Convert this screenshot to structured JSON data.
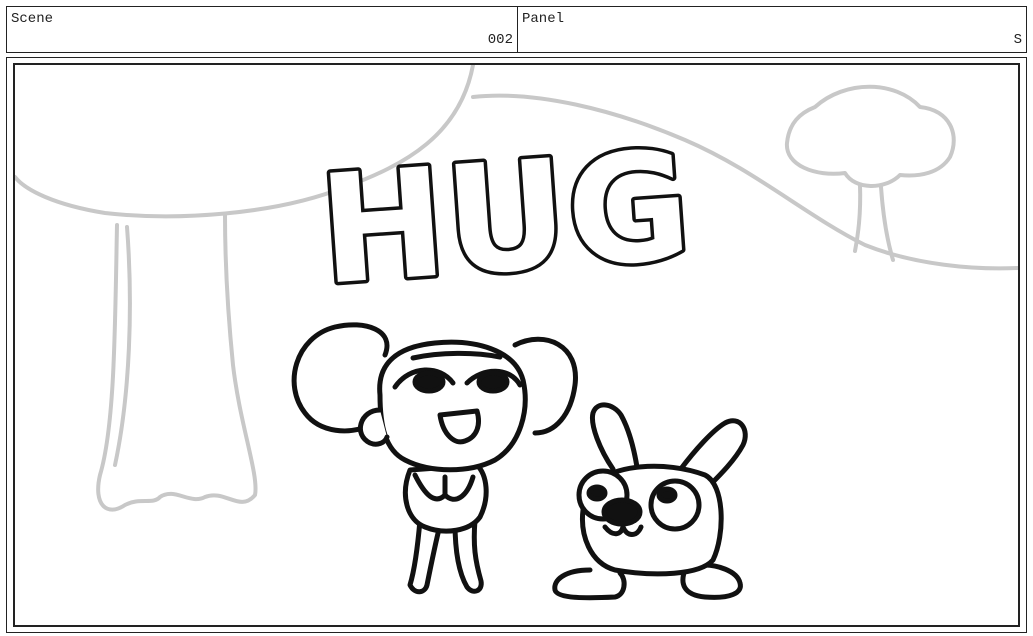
{
  "header": {
    "scene_label": "Scene",
    "scene_value": "002",
    "panel_label": "Panel",
    "panel_value": "S"
  },
  "panel": {
    "title_text": "HUG",
    "background_sketch_color": "#c8c8c8",
    "ink_color": "#111111"
  }
}
